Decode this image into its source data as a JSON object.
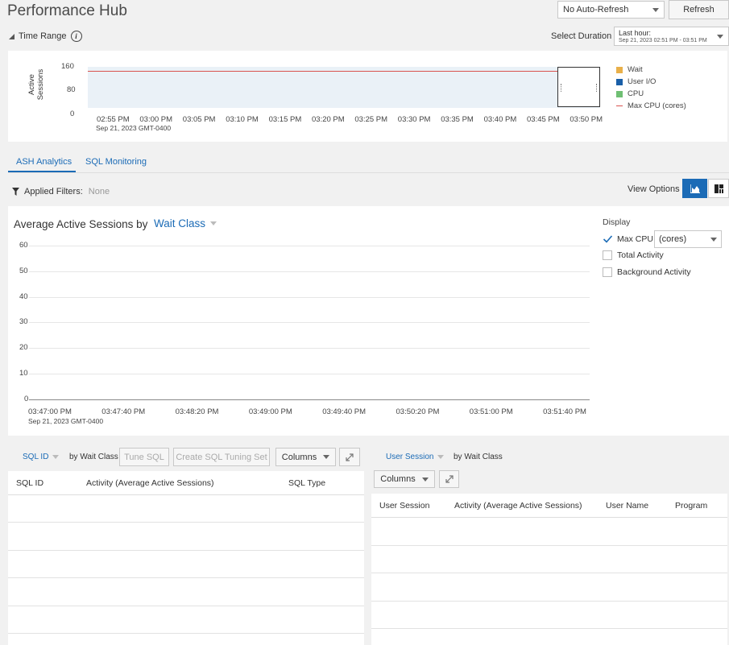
{
  "header": {
    "title": "Performance Hub",
    "auto_refresh": "No Auto-Refresh",
    "refresh_label": "Refresh"
  },
  "time_range": {
    "label": "Time Range",
    "select_duration_label": "Select Duration",
    "duration_title": "Last hour:",
    "duration_range": "Sep 21, 2023 02:51 PM - 03:51 PM",
    "y_axis_label_1": "Active",
    "y_axis_label_2": "Sessions",
    "y_ticks": [
      "160",
      "80",
      "0"
    ],
    "x_ticks": [
      "02:55 PM",
      "03:00 PM",
      "03:05 PM",
      "03:10 PM",
      "03:15 PM",
      "03:20 PM",
      "03:25 PM",
      "03:30 PM",
      "03:35 PM",
      "03:40 PM",
      "03:45 PM",
      "03:50 PM"
    ],
    "x_sub": "Sep 21, 2023 GMT-0400",
    "legend": [
      {
        "label": "Wait",
        "color": "#e9b04a"
      },
      {
        "label": "User I/O",
        "color": "#1a5fa8"
      },
      {
        "label": "CPU",
        "color": "#6fbf73"
      },
      {
        "label": "Max CPU (cores)",
        "color": "#d9534f"
      }
    ]
  },
  "tabs": [
    {
      "label": "ASH Analytics"
    },
    {
      "label": "SQL Monitoring"
    }
  ],
  "filters": {
    "label": "Applied Filters:",
    "value": "None",
    "view_options_label": "View Options"
  },
  "main_chart": {
    "title_prefix": "Average Active Sessions by",
    "dimension": "Wait Class",
    "y_ticks": [
      "60",
      "50",
      "40",
      "30",
      "20",
      "10",
      "0"
    ],
    "x_ticks": [
      "03:47:00 PM",
      "03:47:40 PM",
      "03:48:20 PM",
      "03:49:00 PM",
      "03:49:40 PM",
      "03:50:20 PM",
      "03:51:00 PM",
      "03:51:40 PM"
    ],
    "x_sub": "Sep 21, 2023 GMT-0400"
  },
  "display": {
    "label": "Display",
    "max_cpu": "Max CPU",
    "cores": "(cores)",
    "total_activity": "Total Activity",
    "background_activity": "Background Activity"
  },
  "left_table": {
    "dimension": "SQL ID",
    "by_label": "by Wait Class",
    "tune_sql": "Tune SQL",
    "create_tuning_set": "Create SQL Tuning Set",
    "columns_label": "Columns",
    "headers": [
      "SQL ID",
      "Activity (Average Active Sessions)",
      "SQL Type"
    ]
  },
  "right_table": {
    "dimension": "User Session",
    "by_label": "by Wait Class",
    "columns_label": "Columns",
    "headers": [
      "User Session",
      "Activity (Average Active Sessions)",
      "User Name",
      "Program"
    ]
  }
}
